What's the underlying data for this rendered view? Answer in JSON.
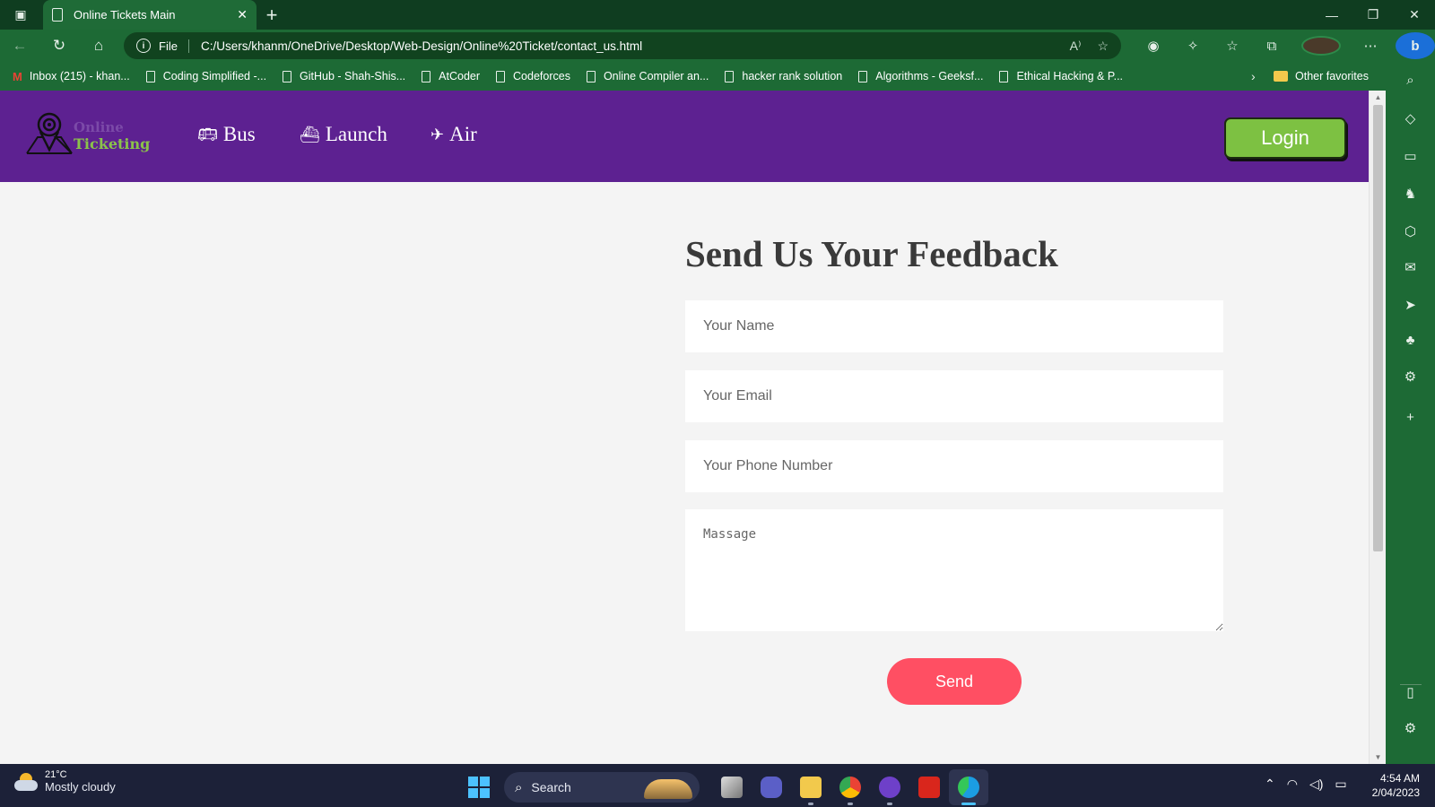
{
  "browser": {
    "tab_title": "Online Tickets Main",
    "scheme_label": "File",
    "url": "C:/Users/khanm/OneDrive/Desktop/Web-Design/Online%20Ticket/contact_us.html",
    "favorites": [
      {
        "label": "Inbox (215) - khan...",
        "icon": "gmail-icon"
      },
      {
        "label": "Coding Simplified -...",
        "icon": "page-icon"
      },
      {
        "label": "GitHub - Shah-Shis...",
        "icon": "page-icon"
      },
      {
        "label": "AtCoder",
        "icon": "page-icon"
      },
      {
        "label": "Codeforces",
        "icon": "page-icon"
      },
      {
        "label": "Online Compiler an...",
        "icon": "page-icon"
      },
      {
        "label": "hacker rank solution",
        "icon": "page-icon"
      },
      {
        "label": "Algorithms - Geeksf...",
        "icon": "page-icon"
      },
      {
        "label": "Ethical Hacking & P...",
        "icon": "page-icon"
      }
    ],
    "other_favorites": "Other favorites",
    "theme_color": "#1d6a35"
  },
  "site": {
    "logo_line1": "Online",
    "logo_line2": "Ticketing",
    "nav": [
      {
        "label": "Bus",
        "icon": "bus-icon"
      },
      {
        "label": "Launch",
        "icon": "ship-icon"
      },
      {
        "label": "Air",
        "icon": "plane-icon"
      }
    ],
    "login_label": "Login",
    "nav_color": "#5d2191",
    "login_color": "#7dc142"
  },
  "form": {
    "heading": "Send Us Your Feedback",
    "name_placeholder": "Your Name",
    "email_placeholder": "Your Email",
    "phone_placeholder": "Your Phone Number",
    "message_placeholder": "Massage",
    "send_label": "Send",
    "send_color": "#ff4f63"
  },
  "taskbar": {
    "temperature": "21°C",
    "weather": "Mostly cloudy",
    "search_label": "Search",
    "time": "4:54 AM",
    "date": "2/04/2023"
  }
}
